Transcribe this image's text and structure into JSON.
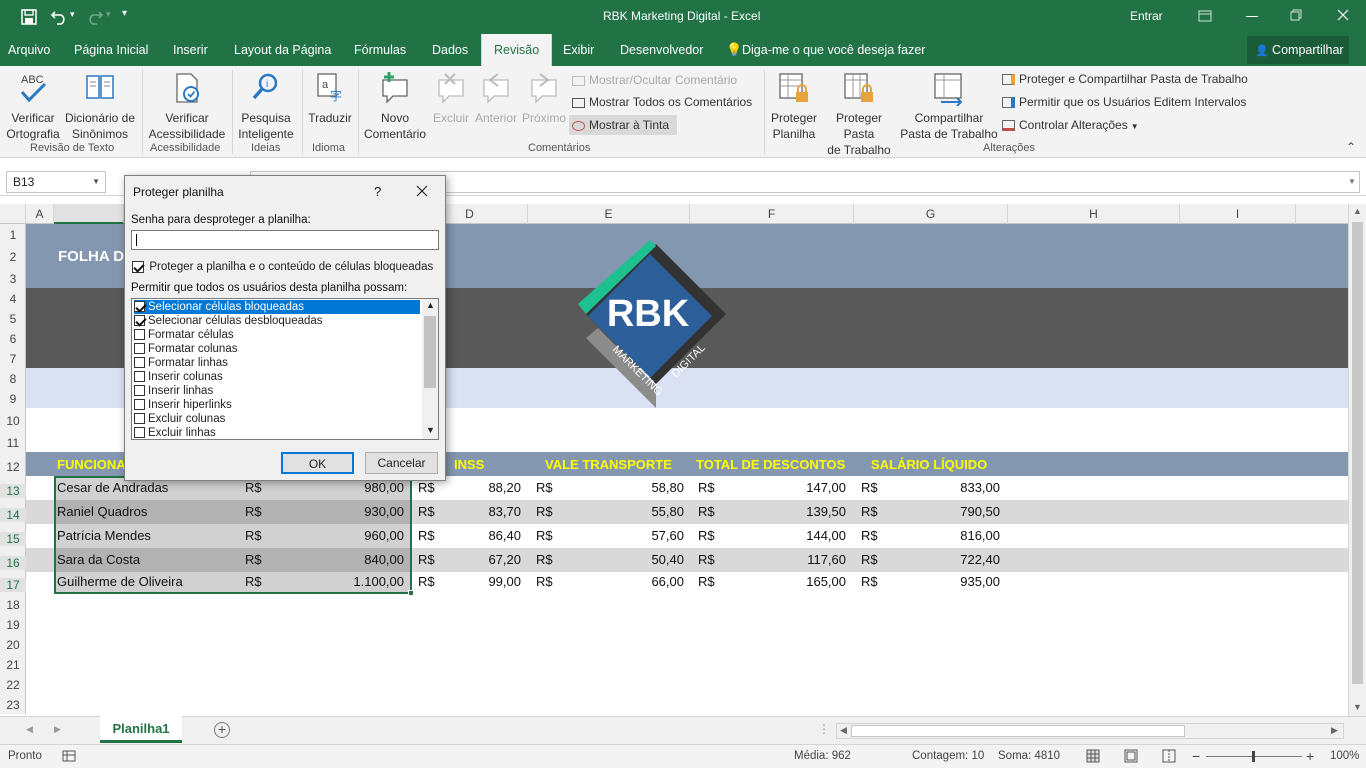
{
  "titlebar": {
    "title": "RBK Marketing Digital  -  Excel",
    "signin": "Entrar"
  },
  "menu": {
    "tabs": [
      "Arquivo",
      "Página Inicial",
      "Inserir",
      "Layout da Página",
      "Fórmulas",
      "Dados",
      "Revisão",
      "Exibir",
      "Desenvolvedor"
    ],
    "active_tab": "Revisão",
    "tell_me": "Diga-me o que você deseja fazer",
    "share": "Compartilhar"
  },
  "ribbon": {
    "spelling": "Verificar\nOrtografia",
    "thesaurus": "Dicionário de\nSinônimos",
    "group_proofing": "Revisão de Texto",
    "accessibility": "Verificar\nAcessibilidade",
    "group_accessibility": "Acessibilidade",
    "smart_lookup": "Pesquisa\nInteligente",
    "group_insights": "Ideias",
    "translate": "Traduzir",
    "group_language": "Idioma",
    "new_comment": "Novo\nComentário",
    "delete": "Excluir",
    "previous": "Anterior",
    "next": "Próximo",
    "show_hide_comment": "Mostrar/Ocultar Comentário",
    "show_all_comments": "Mostrar Todos os Comentários",
    "show_ink": "Mostrar à Tinta",
    "group_comments": "Comentários",
    "protect_sheet": "Proteger\nPlanilha",
    "protect_workbook": "Proteger Pasta\nde Trabalho",
    "share_workbook": "Compartilhar\nPasta de Trabalho",
    "protect_share": "Proteger e Compartilhar Pasta de Trabalho",
    "allow_edit_ranges": "Permitir que os Usuários Editem Intervalos",
    "track_changes": "Controlar Alterações",
    "group_changes": "Alterações"
  },
  "formula_bar": {
    "name_box": "B13"
  },
  "columns": [
    "A",
    "D",
    "E",
    "F",
    "G",
    "H",
    "I"
  ],
  "rows": [
    "1",
    "2",
    "3",
    "4",
    "5",
    "6",
    "7",
    "8",
    "9",
    "10",
    "11",
    "12",
    "13",
    "14",
    "15",
    "16",
    "17",
    "18",
    "19",
    "20",
    "21",
    "22",
    "23"
  ],
  "sheet": {
    "title_partial": "FOLHA D",
    "logo_text": "RBK",
    "logo_sub1": "MARKETING",
    "logo_sub2": "DIGITAL",
    "headers": [
      "FUNCIONA",
      "INSS",
      "VALE TRANSPORTE",
      "TOTAL DE DESCONTOS",
      "SALÁRIO LÍQUIDO"
    ],
    "currency": "R$",
    "data": [
      {
        "name": "Cesar de Andradas",
        "salary": "980,00",
        "inss": "88,20",
        "vt": "58,80",
        "total": "147,00",
        "net": "833,00"
      },
      {
        "name": "Raniel Quadros",
        "salary": "930,00",
        "inss": "83,70",
        "vt": "55,80",
        "total": "139,50",
        "net": "790,50"
      },
      {
        "name": "Patrícia Mendes",
        "salary": "960,00",
        "inss": "86,40",
        "vt": "57,60",
        "total": "144,00",
        "net": "816,00"
      },
      {
        "name": "Sara da Costa",
        "salary": "840,00",
        "inss": "67,20",
        "vt": "50,40",
        "total": "117,60",
        "net": "722,40"
      },
      {
        "name": "Guilherme de Oliveira",
        "salary": "1.100,00",
        "inss": "99,00",
        "vt": "66,00",
        "total": "165,00",
        "net": "935,00"
      }
    ]
  },
  "dialog": {
    "title": "Proteger planilha",
    "help": "?",
    "password_label": "Senha para desproteger a planilha:",
    "protect_label": "Proteger a planilha e o conteúdo de células bloqueadas",
    "allow_label": "Permitir que todos os usuários desta planilha possam:",
    "options": [
      {
        "label": "Selecionar células bloqueadas",
        "checked": true
      },
      {
        "label": "Selecionar células desbloqueadas",
        "checked": true
      },
      {
        "label": "Formatar células",
        "checked": false
      },
      {
        "label": "Formatar colunas",
        "checked": false
      },
      {
        "label": "Formatar linhas",
        "checked": false
      },
      {
        "label": "Inserir colunas",
        "checked": false
      },
      {
        "label": "Inserir linhas",
        "checked": false
      },
      {
        "label": "Inserir hiperlinks",
        "checked": false
      },
      {
        "label": "Excluir colunas",
        "checked": false
      },
      {
        "label": "Excluir linhas",
        "checked": false
      }
    ],
    "ok": "OK",
    "cancel": "Cancelar"
  },
  "sheet_tab": "Planilha1",
  "status": {
    "ready": "Pronto",
    "average": "Média: 962",
    "count": "Contagem: 10",
    "sum": "Soma: 4810",
    "zoom": "100%"
  },
  "colors": {
    "excel_green": "#217346",
    "band_blue": "#8497b0",
    "band_dark": "#595959",
    "band_light": "#d9e1f2",
    "header_row": "#8497b0",
    "header_text": "#ffff00"
  }
}
